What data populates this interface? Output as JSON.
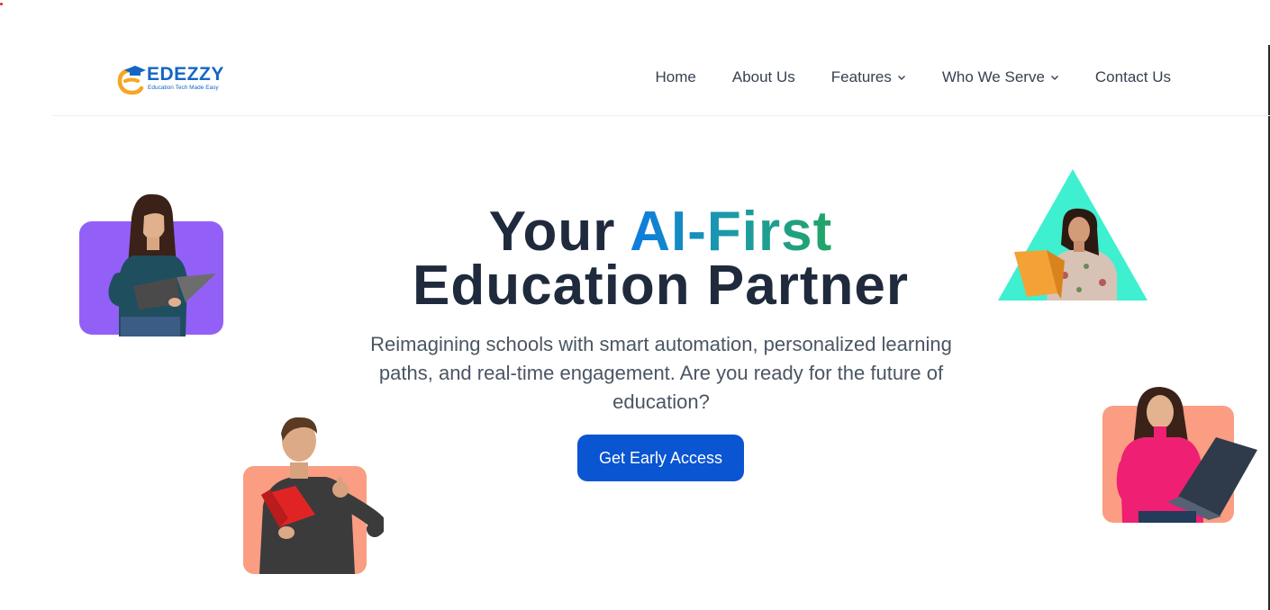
{
  "brand": {
    "name": "EDEZZY",
    "tagline": "Education Tech Made Easy",
    "color": "#1466c4",
    "accent": "#f5a623"
  },
  "nav": {
    "items": [
      {
        "label": "Home",
        "has_dropdown": false
      },
      {
        "label": "About Us",
        "has_dropdown": false
      },
      {
        "label": "Features",
        "has_dropdown": true
      },
      {
        "label": "Who We Serve",
        "has_dropdown": true
      },
      {
        "label": "Contact Us",
        "has_dropdown": false
      }
    ]
  },
  "hero": {
    "title_part1": "Your ",
    "title_highlight": "AI-First",
    "title_line2": "Education Partner",
    "subtitle": "Reimagining schools with smart automation, personalized learning paths, and real-time engagement. Are you ready for the future of education?",
    "cta_label": "Get Early Access"
  },
  "colors": {
    "cta": "#0a55d1",
    "purple_card": "#9360f7",
    "salmon_card": "#fa9d82",
    "teal_triangle": "#3ef0cf",
    "heading": "#1f2a3c"
  }
}
